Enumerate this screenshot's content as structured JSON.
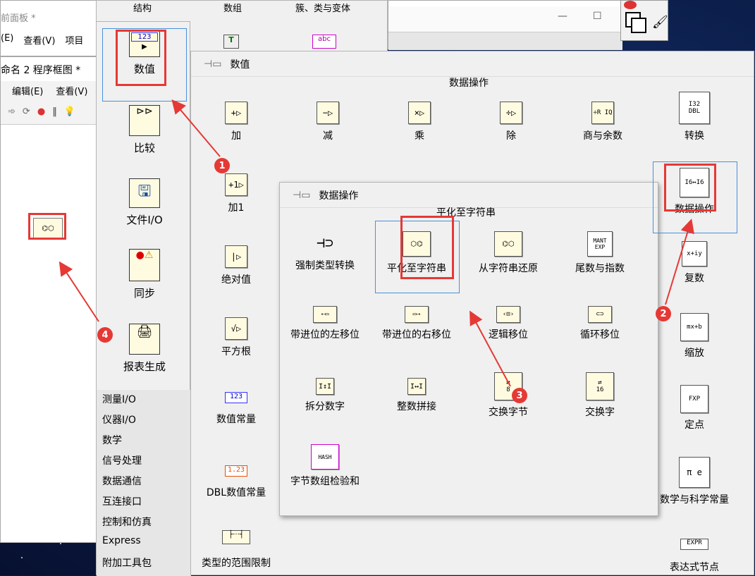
{
  "front_panel": {
    "title": "前面板 *",
    "menu": [
      "(E)",
      "查看(V)",
      "项目"
    ]
  },
  "block_diagram": {
    "title": "命名 2 程序框图 *",
    "menu": [
      "编辑(E)",
      "查看(V)"
    ]
  },
  "top_palette": {
    "labels": [
      "结构",
      "数组",
      "簇、类与变体"
    ]
  },
  "left_palette": {
    "items": [
      {
        "label": "数值",
        "icon": "123"
      },
      {
        "label": "比较",
        "icon": "cmp"
      },
      {
        "label": "文件I/O",
        "icon": "file"
      },
      {
        "label": "同步",
        "icon": "sync"
      },
      {
        "label": "报表生成",
        "icon": "report"
      }
    ],
    "categories": [
      "测量I/O",
      "仪器I/O",
      "数学",
      "信号处理",
      "数据通信",
      "互连接口",
      "控制和仿真",
      "Express",
      "附加工具包"
    ]
  },
  "numeric_palette": {
    "title": "数值",
    "subtitle": "数据操作",
    "left_column": [
      "加",
      "加1",
      "绝对值",
      "平方根",
      "数值常量",
      "DBL数值常量",
      "类型的范围限制"
    ],
    "row1": [
      "减",
      "乘",
      "除",
      "商与余数",
      "转换"
    ],
    "right_column": [
      "数据操作",
      "复数",
      "缩放",
      "定点",
      "数学与科学常量",
      "表达式节点"
    ],
    "icons": {
      "numeric_const": "123",
      "dbl_const": "1.23"
    }
  },
  "data_manip_palette": {
    "title": "数据操作",
    "hover_label": "平化至字符串",
    "items": [
      "强制类型转换",
      "平化至字符串",
      "从字符串还原",
      "尾数与指数",
      "带进位的左移位",
      "带进位的右移位",
      "逻辑移位",
      "循环移位",
      "拆分数字",
      "整数拼接",
      "交换字节",
      "交换字",
      "字节数组检验和"
    ]
  },
  "badges": [
    "1",
    "2",
    "3",
    "4"
  ],
  "colors": {
    "annotation_red": "#e53935",
    "highlight_blue": "#4a90d9"
  }
}
